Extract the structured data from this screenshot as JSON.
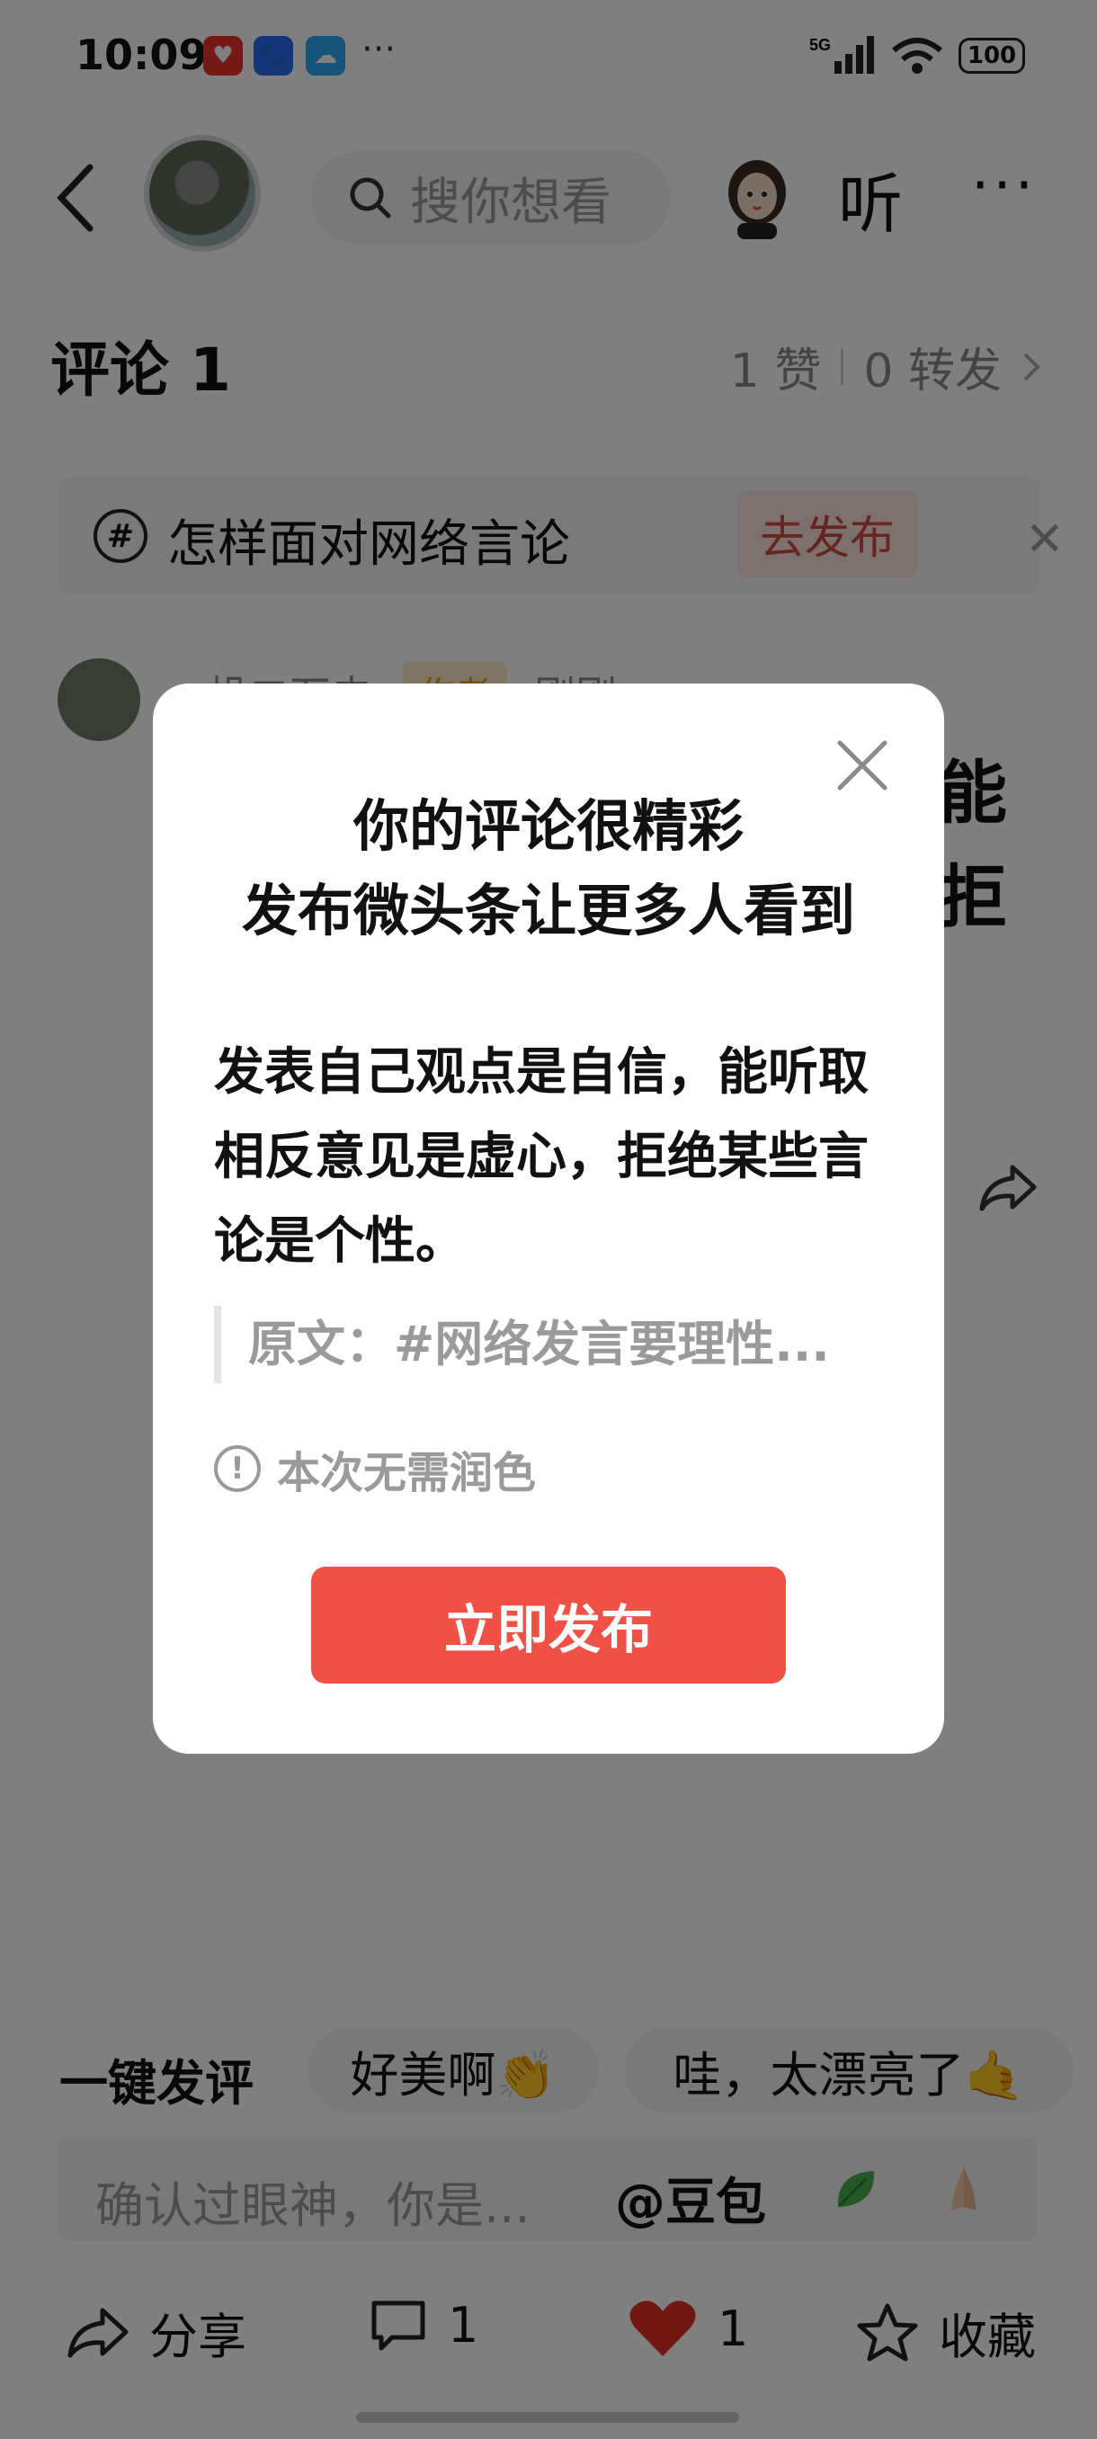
{
  "status_bar": {
    "time": "10:09",
    "more": "···",
    "network": "5G",
    "battery": "100"
  },
  "nav": {
    "search_placeholder": "搜你想看",
    "listen_label": "听",
    "more": "···"
  },
  "comments": {
    "title": "评论 1",
    "likes": "1 赞",
    "reposts": "0 转发"
  },
  "topic": {
    "label": "怎样面对网络言论",
    "publish_label": "去发布"
  },
  "comment": {
    "author": "一帆二石夫",
    "badge": "作者",
    "time": "刚刚"
  },
  "quick_replies": {
    "title": "一键发评",
    "chips": [
      "好美啊👏",
      "哇，太漂亮了🤙"
    ]
  },
  "input": {
    "placeholder": "确认过眼神，你是...",
    "mention": "@豆包"
  },
  "bottom_bar": {
    "share": "分享",
    "comment_count": "1",
    "like_count": "1",
    "favorite": "收藏"
  },
  "modal": {
    "title_line1": "你的评论很精彩",
    "title_line2": "发布微头条让更多人看到",
    "body": "发表自己观点是自信，能听取相反意见是虚心，拒绝某些言论是个性。",
    "quote": "原文：#网络发言要理性...",
    "hint": "本次无需润色",
    "publish_button": "立即发布"
  },
  "colors": {
    "accent": "#ef5147",
    "like_red": "#e02e24",
    "overlay": "rgba(0,0,0,0.5)"
  }
}
